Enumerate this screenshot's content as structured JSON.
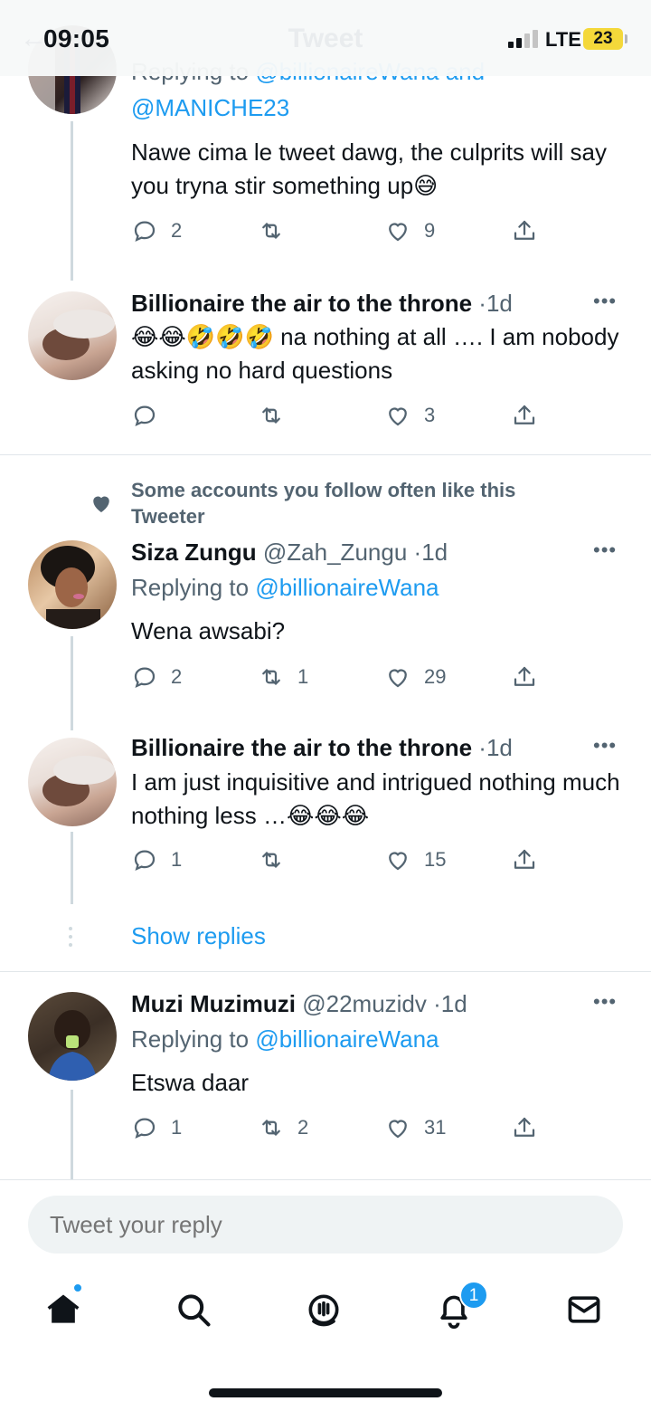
{
  "status": {
    "time": "09:05",
    "network": "LTE",
    "battery": "23"
  },
  "header": {
    "title": "Tweet"
  },
  "tweets": [
    {
      "reply_prefix": "Replying to",
      "reply_handles_line1": "@billionaireWana and",
      "reply_handles_line2": "@MANICHE23",
      "text": "Nawe cima le tweet dawg, the culprits will say you tryna stir something up😅",
      "replies": "2",
      "retweets": "",
      "likes": "9"
    },
    {
      "name": "Billionaire the air to the throne",
      "handle": "",
      "dot": "·",
      "ago": "1d",
      "text": "😂😂🤣🤣🤣 na nothing at all …. I am nobody asking no hard questions",
      "replies": "",
      "retweets": "",
      "likes": "3"
    },
    {
      "social_context": "Some accounts you follow often like this Tweeter",
      "name": "Siza Zungu",
      "handle": "@Zah_Zungu",
      "dot": "·",
      "ago": "1d",
      "reply_prefix": "Replying to",
      "reply_handle": "@billionaireWana",
      "text": "Wena awsabi?",
      "replies": "2",
      "retweets": "1",
      "likes": "29"
    },
    {
      "name": "Billionaire the air to the throne",
      "handle": "",
      "dot": "·",
      "ago": "1d",
      "text": "I am just inquisitive and intrigued nothing much nothing less …😂😂😂",
      "replies": "1",
      "retweets": "",
      "likes": "15"
    },
    {
      "name": "Muzi Muzimuzi",
      "handle": "@22muzidv",
      "dot": "·",
      "ago": "1d",
      "reply_prefix": "Replying to",
      "reply_handle": "@billionaireWana",
      "text": "Etswa daar",
      "replies": "1",
      "retweets": "2",
      "likes": "31"
    }
  ],
  "show_replies": "Show replies",
  "reply_box": {
    "placeholder": "Tweet your reply"
  },
  "tabbar": {
    "notifications_badge": "1"
  },
  "colors": {
    "accent": "#1d9bf0",
    "muted": "#536471",
    "battery": "#f4d83a"
  }
}
